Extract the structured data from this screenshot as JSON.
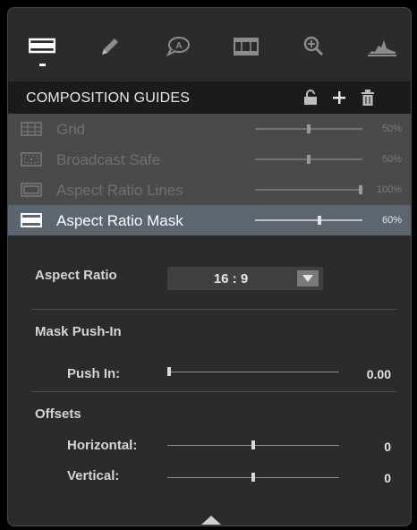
{
  "toolbar": {
    "buttons": [
      {
        "name": "composition-guides-tab",
        "icon": "aspect-rectangle-icon",
        "active": true
      },
      {
        "name": "annotation-pencil-tab",
        "icon": "pencil-icon",
        "active": false
      },
      {
        "name": "speech-bubble-tab",
        "icon": "speech-bubble-a-icon",
        "active": false
      },
      {
        "name": "film-strip-tab",
        "icon": "film-strip-icon",
        "active": false
      },
      {
        "name": "zoom-tab",
        "icon": "magnifier-plus-icon",
        "active": false
      },
      {
        "name": "histogram-tab",
        "icon": "histogram-icon",
        "active": false
      }
    ]
  },
  "header": {
    "title": "COMPOSITION GUIDES",
    "icons": [
      "unlock-icon",
      "plus-icon",
      "trash-icon"
    ]
  },
  "guides": [
    {
      "label": "Grid",
      "percent": "50%",
      "value": 0.5,
      "active": false,
      "icon": "grid-icon"
    },
    {
      "label": "Broadcast Safe",
      "percent": "50%",
      "value": 0.5,
      "active": false,
      "icon": "broadcast-safe-icon"
    },
    {
      "label": "Aspect Ratio Lines",
      "percent": "100%",
      "value": 1.0,
      "active": false,
      "icon": "aspect-lines-icon"
    },
    {
      "label": "Aspect Ratio Mask",
      "percent": "60%",
      "value": 0.6,
      "active": true,
      "icon": "aspect-mask-icon"
    }
  ],
  "aspect": {
    "label": "Aspect Ratio",
    "value": "16 : 9"
  },
  "mask": {
    "section": "Mask Push-In",
    "push_in_label": "Push In:",
    "push_in_value": "0.00",
    "push_in_level": 0.0
  },
  "offsets": {
    "section": "Offsets",
    "horizontal_label": "Horizontal:",
    "horizontal_value": "0",
    "horizontal_level": 0.5,
    "vertical_label": "Vertical:",
    "vertical_value": "0",
    "vertical_level": 0.5
  },
  "colors": {
    "panel_bg": "#2b2b2b",
    "header_bg": "#1b1b1b",
    "inactive_row": "#4a4a4a",
    "active_row": "#5b6670"
  }
}
